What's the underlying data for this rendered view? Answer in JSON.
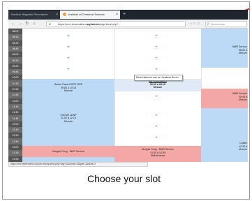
{
  "caption": "Choose your slot",
  "browser": {
    "tabs": [
      {
        "label": "Nuclear Magnetic Resonance",
        "active": false
      },
      {
        "label": "Institute of Chemical Science",
        "active": true
      }
    ],
    "url": {
      "prefix": "https://nmr.reservation.",
      "domain": "myhub.ch",
      "suffix": "/php/view.php?..."
    },
    "search_placeholder": "Rechercher"
  },
  "timetable": {
    "times": [
      "08:00",
      "08:15",
      "08:30",
      "08:45",
      "09:00",
      "09:15",
      "09:30",
      "09:45",
      "10:00",
      "10:15",
      "10:30",
      "10:45",
      "11:00",
      "11:15",
      "11:30",
      "11:45",
      "12:00",
      "12:15",
      "12:30",
      "12:45",
      "13:00",
      "13:15",
      "13:30"
    ],
    "blocks": {
      "col1_research": [
        "Rainer Paetz EGOT GDP",
        "09:00 à 10:15",
        "Mesure"
      ],
      "col1_booking": [
        "CSCMS JDNP",
        "11:00 à 12:15",
        "Mesure"
      ],
      "col1_maintenance": "Morgan Feng - NMR Service",
      "col2_my_reservation": [
        "My reservation",
        "09:00 à 09:15",
        "Mesure"
      ],
      "col2_maintenance": [
        "Morgan Feng - NMR Service",
        "13:00 à 13:30",
        "Maintenance"
      ],
      "col3_top": [
        "NMR Service",
        "08:00 à",
        "Mesure"
      ],
      "col3_service": [
        "NMR Service",
        "09:45 à",
        "Mesure"
      ],
      "col3_bottom": [
        "Cassie",
        "12:30 à",
        "Mesure"
      ]
    },
    "tooltip": "Réservation au nom de Jonathan Bovon"
  },
  "statusbar": "https://nmr.reservation.myhub.ch/php/view.php?day=2&month=3&type=1&area=2"
}
